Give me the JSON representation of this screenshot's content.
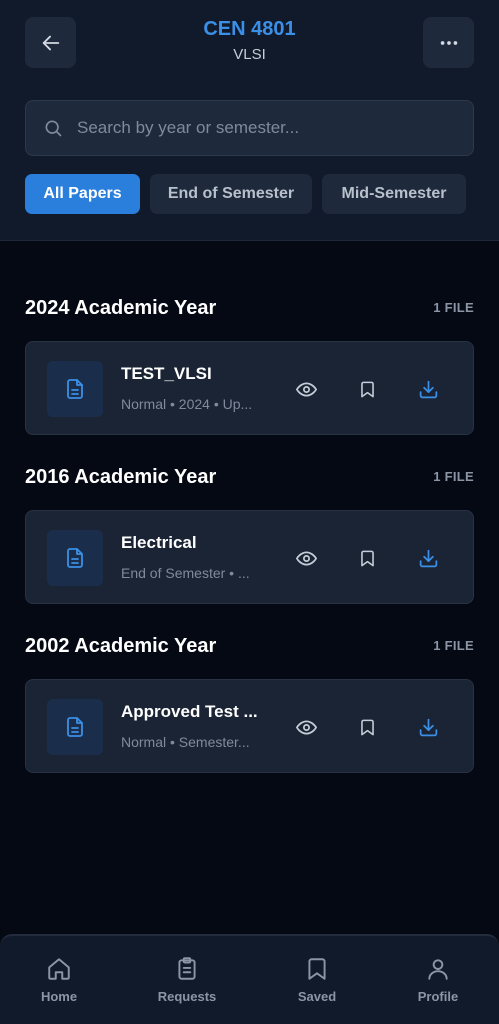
{
  "header": {
    "title": "CEN 4801",
    "subtitle": "VLSI",
    "back_icon": "arrow-left-icon",
    "more_icon": "more-horizontal-icon"
  },
  "search": {
    "placeholder": "Search by year or semester...",
    "value": ""
  },
  "filters": [
    {
      "label": "All Papers",
      "active": true
    },
    {
      "label": "End of Semester",
      "active": false
    },
    {
      "label": "Mid-Semester",
      "active": false
    }
  ],
  "sections": [
    {
      "title": "2024 Academic Year",
      "count": "1 FILE",
      "files": [
        {
          "name": "TEST_VLSI",
          "meta": "Normal • 2024 • Up..."
        }
      ]
    },
    {
      "title": "2016 Academic Year",
      "count": "1 FILE",
      "files": [
        {
          "name": "Electrical",
          "meta": "End of Semester • ..."
        }
      ]
    },
    {
      "title": "2002 Academic Year",
      "count": "1 FILE",
      "files": [
        {
          "name": "Approved Test ...",
          "meta": "Normal • Semester..."
        }
      ]
    }
  ],
  "nav": [
    {
      "label": "Home",
      "icon": "home-icon"
    },
    {
      "label": "Requests",
      "icon": "clipboard-icon"
    },
    {
      "label": "Saved",
      "icon": "bookmark-icon"
    },
    {
      "label": "Profile",
      "icon": "user-icon"
    }
  ],
  "colors": {
    "accent": "#2a7fdc",
    "title_blue": "#3b8fe6",
    "background": "#050914",
    "surface": "#1b2434"
  }
}
